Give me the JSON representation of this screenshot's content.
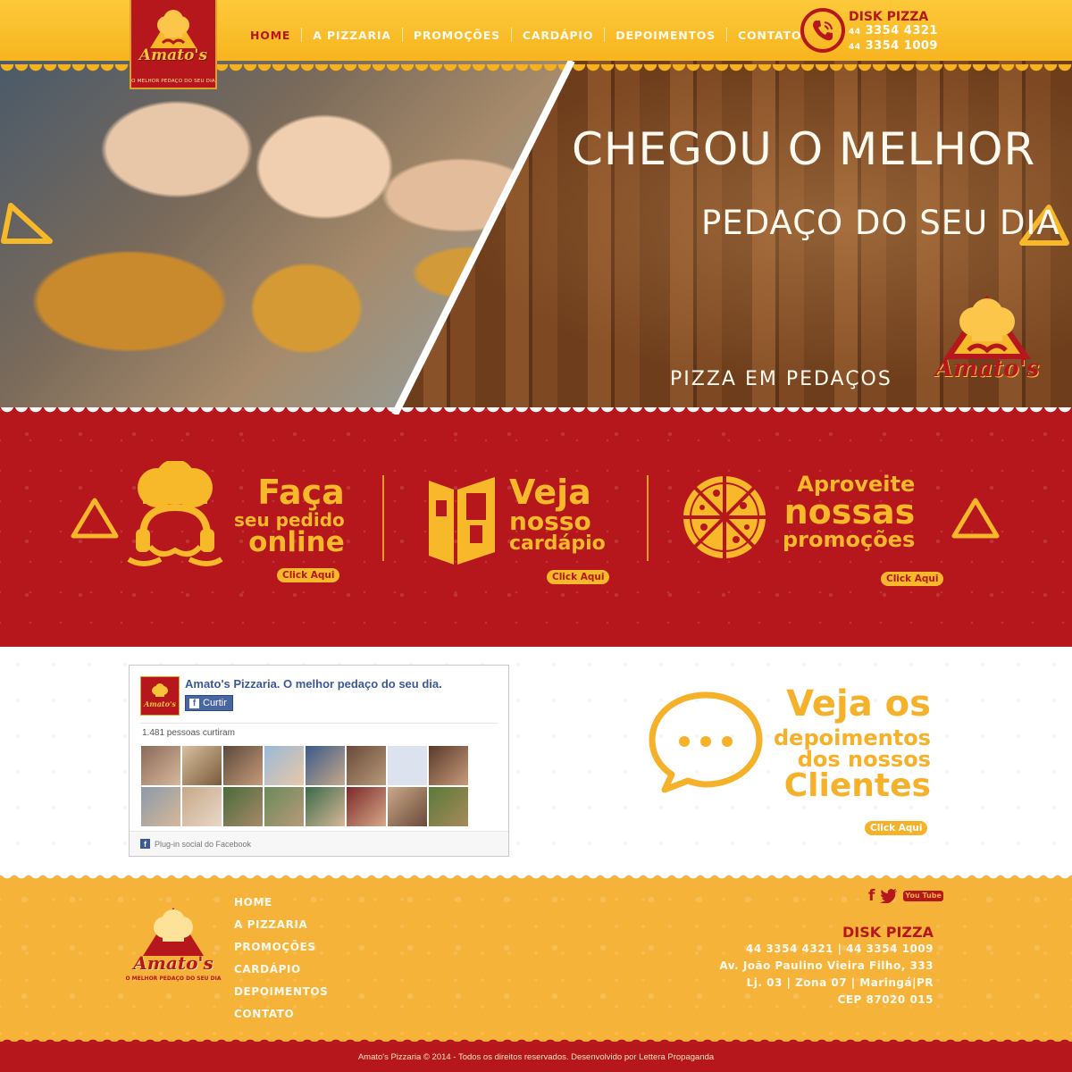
{
  "brand": {
    "name": "Amato's",
    "tagline": "O MELHOR PEDAÇO DO SEU DIA",
    "colors": {
      "red": "#b5171d",
      "yellow": "#f6b33a",
      "gold": "#f7b82a"
    }
  },
  "nav": {
    "items": [
      {
        "label": "HOME",
        "active": true
      },
      {
        "label": "A PIZZARIA"
      },
      {
        "label": "PROMOÇÕES"
      },
      {
        "label": "CARDÁPIO"
      },
      {
        "label": "DEPOIMENTOS"
      },
      {
        "label": "CONTATO"
      }
    ]
  },
  "header_contact": {
    "icon": "phone-icon",
    "title": "DISK PIZZA",
    "phone1_ddd": "44",
    "phone1": "3354 4321",
    "phone2_ddd": "44",
    "phone2": "3354 1009"
  },
  "hero": {
    "title": "CHEGOU O MELHOR",
    "subtitle": "PEDAÇO DO SEU DIA",
    "tagline": "PIZZA EM PEDAÇOS",
    "logo_text": "Amato's"
  },
  "features": [
    {
      "icon": "chef-headset-icon",
      "lines": [
        "Faça",
        "seu pedido",
        "online"
      ],
      "cta": "Click Aqui"
    },
    {
      "icon": "menu-book-icon",
      "lines": [
        "Veja",
        "nosso",
        "cardápio"
      ],
      "cta": "Click Aqui"
    },
    {
      "icon": "pizza-icon",
      "lines": [
        "Aproveite",
        "nossas",
        "promoções"
      ],
      "cta": "Click Aqui"
    }
  ],
  "facebook": {
    "page_name": "Amato's Pizzaria. O melhor pedaço do seu dia.",
    "like_button": "Curtir",
    "likes_text": "1.481 pessoas curtiram",
    "footer_text": "Plug-in social do Facebook"
  },
  "testimonials": {
    "icon": "speech-bubble-icon",
    "lines": [
      "Veja os",
      "depoimentos",
      "dos nossos",
      "Clientes"
    ],
    "cta": "Click Aqui"
  },
  "footer": {
    "logo_text": "Amato's",
    "tagline": "O MELHOR PEDAÇO DO SEU DIA",
    "nav": [
      "HOME",
      "A PIZZARIA",
      "PROMOÇÕES",
      "CARDÁPIO",
      "DEPOIMENTOS",
      "CONTATO"
    ],
    "social": {
      "facebook": "f",
      "twitter": "t",
      "youtube": "You Tube"
    },
    "contact_title": "DISK PIZZA",
    "phones": "44 3354 4321 | 44 3354 1009",
    "address1": "Av. João Paulino Vieira Filho, 333",
    "address2": "Lj. 03 | Zona 07 | Maringá|PR",
    "cep": "CEP 87020 015"
  },
  "copyright": "Amato's Pizzaria © 2014 - Todos os direitos reservados. Desenvolvido por Lettera Propaganda"
}
